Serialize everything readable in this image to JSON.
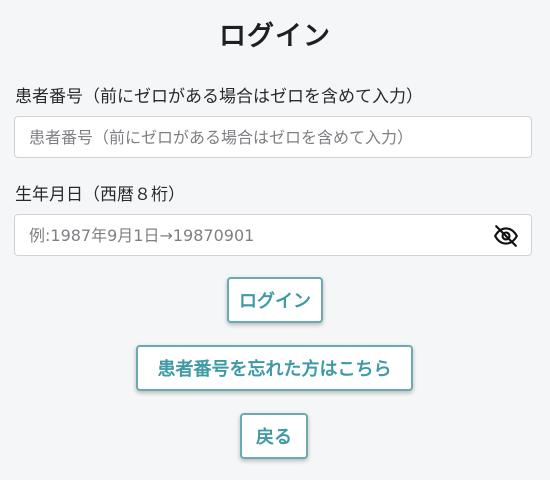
{
  "page": {
    "title": "ログイン"
  },
  "patient_id": {
    "label": "患者番号（前にゼロがある場合はゼロを含めて入力）",
    "placeholder": "患者番号（前にゼロがある場合はゼロを含めて入力）",
    "value": ""
  },
  "birthdate": {
    "label": "生年月日（西暦８桁）",
    "placeholder": "例:1987年9月1日→19870901",
    "value": "",
    "toggle_icon": "eye-slash-icon"
  },
  "buttons": {
    "login": "ログイン",
    "forgot": "患者番号を忘れた方はこちら",
    "back": "戻る"
  },
  "colors": {
    "accent": "#3f9aa6",
    "button_border": "#6aaab2",
    "background": "#f5f6f8"
  }
}
